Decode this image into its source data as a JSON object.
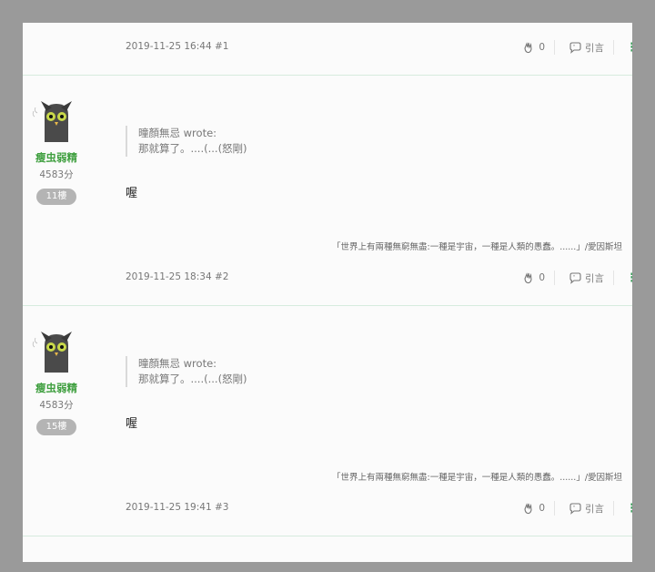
{
  "posts": [
    {
      "date": "2019-11-25 16:44",
      "floor": "#1",
      "likes": "0",
      "quote_label": "引言"
    },
    {
      "author": "瘦虫弱精",
      "score": "4583分",
      "floor_badge": "11樓",
      "quote_author": "曈顏無忌 wrote:",
      "quote_text": "那就算了。....(...(怒剛)",
      "content": "喔",
      "signature": "「世界上有兩種無窮無盡:一種是宇宙，一種是人類的愚蠢。......」/愛因斯坦",
      "date": "2019-11-25 18:34",
      "floor": "#2",
      "likes": "0",
      "quote_label": "引言"
    },
    {
      "author": "瘦虫弱精",
      "score": "4583分",
      "floor_badge": "15樓",
      "quote_author": "曈顏無忌 wrote:",
      "quote_text": "那就算了。....(...(怒剛)",
      "content": "喔",
      "signature": "「世界上有兩種無窮無盡:一種是宇宙，一種是人類的愚蠢。......」/愛因斯坦",
      "date": "2019-11-25 19:41",
      "floor": "#3",
      "likes": "0",
      "quote_label": "引言"
    }
  ],
  "icons": {
    "like": "clap-icon",
    "quote": "quote-icon",
    "more": "more-vertical-icon"
  },
  "colors": {
    "accent": "#3f9f3f",
    "divider": "#d6ebde",
    "badge": "#b4b4b4"
  }
}
